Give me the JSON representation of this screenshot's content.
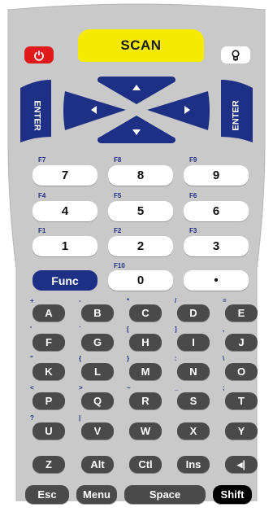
{
  "top": {
    "power_icon": "power-icon",
    "scan_label": "SCAN",
    "light_icon": "bulb-icon"
  },
  "nav": {
    "enter_left": "ENTER",
    "enter_right": "ENTER",
    "up_icon": "arrow-up-icon",
    "down_icon": "arrow-down-icon",
    "left_icon": "arrow-left-icon",
    "right_icon": "arrow-right-icon"
  },
  "numpad": {
    "rows": [
      [
        {
          "fn": "F7",
          "label": "7"
        },
        {
          "fn": "F8",
          "label": "8"
        },
        {
          "fn": "F9",
          "label": "9"
        }
      ],
      [
        {
          "fn": "F4",
          "label": "4"
        },
        {
          "fn": "F5",
          "label": "5"
        },
        {
          "fn": "F6",
          "label": "6"
        }
      ],
      [
        {
          "fn": "F1",
          "label": "1"
        },
        {
          "fn": "F2",
          "label": "2"
        },
        {
          "fn": "F3",
          "label": "3"
        }
      ],
      [
        {
          "fn": "",
          "label": "Func"
        },
        {
          "fn": "F10",
          "label": "0"
        },
        {
          "fn": "",
          "label": "•"
        }
      ]
    ]
  },
  "alpha": {
    "rows": [
      [
        {
          "sym": "+",
          "label": "A"
        },
        {
          "sym": "-",
          "label": "B"
        },
        {
          "sym": "*",
          "label": "C"
        },
        {
          "sym": "/",
          "label": "D"
        },
        {
          "sym": "=",
          "label": "E"
        }
      ],
      [
        {
          "sym": "'",
          "label": "F"
        },
        {
          "sym": "`",
          "label": "G"
        },
        {
          "sym": "[",
          "label": "H"
        },
        {
          "sym": "]",
          "label": "I"
        },
        {
          "sym": ",",
          "label": "J"
        }
      ],
      [
        {
          "sym": "\"",
          "label": "K"
        },
        {
          "sym": "{",
          "label": "L"
        },
        {
          "sym": "}",
          "label": "M"
        },
        {
          "sym": ":",
          "label": "N"
        },
        {
          "sym": "\\",
          "label": "O"
        }
      ],
      [
        {
          "sym": "<",
          "label": "P"
        },
        {
          "sym": ">",
          "label": "Q"
        },
        {
          "sym": "~",
          "label": "R"
        },
        {
          "sym": "_",
          "label": "S"
        },
        {
          "sym": ";",
          "label": "T"
        }
      ],
      [
        {
          "sym": "?",
          "label": "U"
        },
        {
          "sym": "|",
          "label": "V"
        },
        {
          "sym": "",
          "label": "W"
        },
        {
          "sym": "",
          "label": "X"
        },
        {
          "sym": "",
          "label": "Y"
        }
      ],
      [
        {
          "sym": "",
          "label": "Z"
        },
        {
          "sym": "",
          "label": "Alt"
        },
        {
          "sym": "",
          "label": "Ctl"
        },
        {
          "sym": "",
          "label": "Ins"
        },
        {
          "sym": "",
          "label": "◂|"
        }
      ]
    ]
  },
  "bottom": {
    "esc": "Esc",
    "menu": "Menu",
    "space": "Space",
    "shift": "Shift"
  },
  "colors": {
    "body": "#c9c9c9",
    "scan": "#f6ea00",
    "power": "#e0191b",
    "nav_blue": "#1e2f86",
    "dark_key": "#4a4a4a",
    "shift": "#000000"
  }
}
